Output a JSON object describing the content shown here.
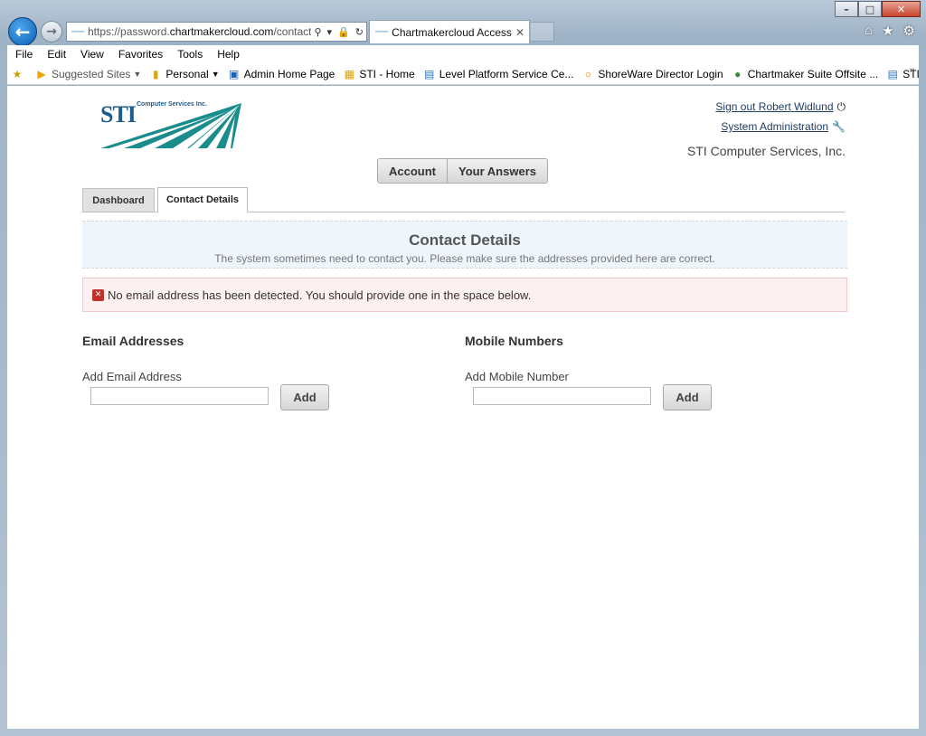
{
  "browser": {
    "url_prefix": "https://password.",
    "url_domain": "chartmakercloud.com",
    "url_path": "/contact.htm",
    "tab_title": "Chartmakercloud Access M...",
    "menu": [
      "File",
      "Edit",
      "View",
      "Favorites",
      "Tools",
      "Help"
    ],
    "favorites": [
      {
        "label": "Suggested Sites",
        "icon": "bing-icon",
        "dropdown": true
      },
      {
        "label": "Personal",
        "icon": "folder-icon",
        "dropdown": true
      },
      {
        "label": "Admin Home Page",
        "icon": "office-icon"
      },
      {
        "label": "STI - Home",
        "icon": "sti-icon"
      },
      {
        "label": "Level Platform Service Ce...",
        "icon": "ie-page-icon"
      },
      {
        "label": "ShoreWare Director Login",
        "icon": "shoretel-icon"
      },
      {
        "label": "Chartmaker Suite Offsite ...",
        "icon": "globe-icon"
      },
      {
        "label": "STI Remote Support",
        "icon": "ie-page-icon"
      }
    ]
  },
  "page": {
    "logo_text": "STI",
    "logo_sub": "Computer Services Inc.",
    "signout": "Sign out Robert Widlund",
    "sysadmin": "System Administration",
    "company": "STI Computer Services, Inc.",
    "buttons": {
      "account": "Account",
      "answers": "Your Answers"
    },
    "tabs": {
      "dashboard": "Dashboard",
      "contact": "Contact Details"
    },
    "header": {
      "title": "Contact Details",
      "subtitle": "The system sometimes need to contact you. Please make sure the addresses provided here are correct."
    },
    "alert": "No email address has been detected. You should provide one in the space below.",
    "email": {
      "title": "Email Addresses",
      "label": "Add Email Address",
      "value": "",
      "button": "Add"
    },
    "mobile": {
      "title": "Mobile Numbers",
      "label": "Add Mobile Number",
      "value": "",
      "button": "Add"
    }
  }
}
